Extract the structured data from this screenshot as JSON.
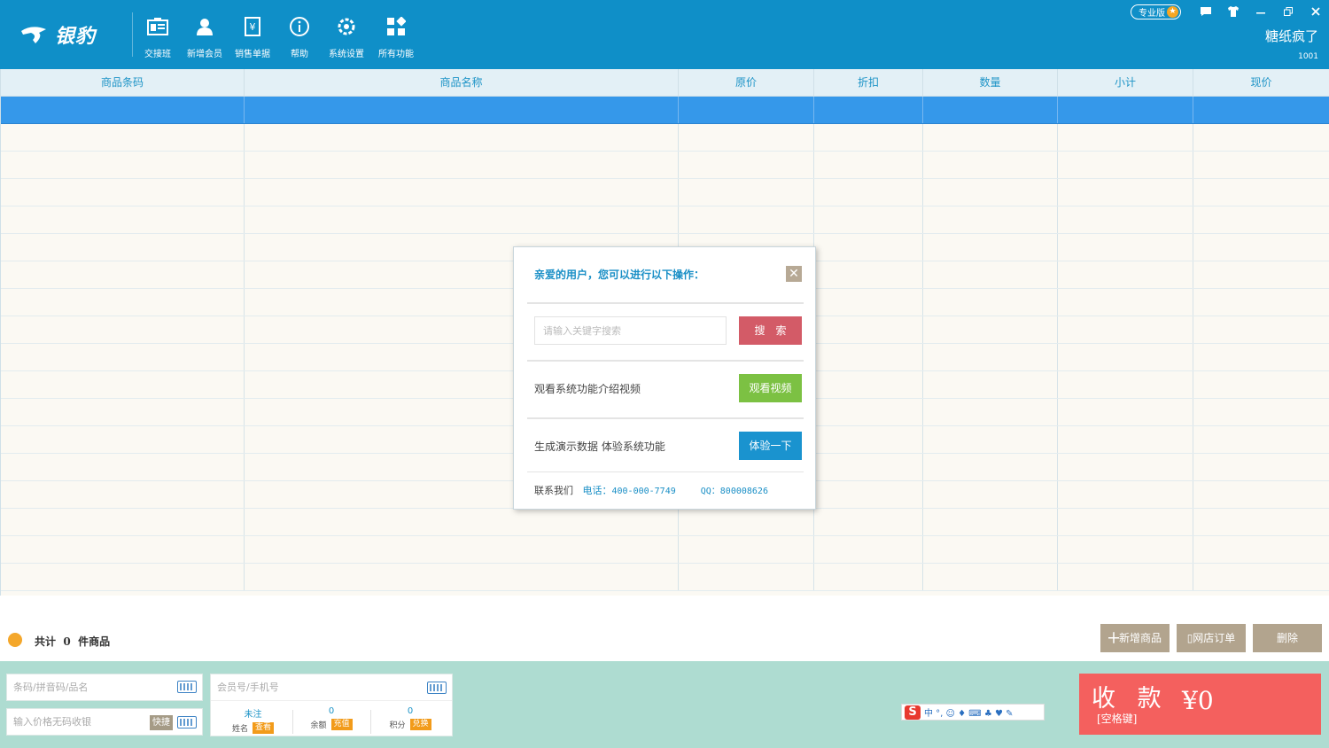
{
  "app": {
    "brand": "银豹"
  },
  "toolbar": {
    "items": [
      {
        "label": "交接班",
        "icon": "shift-handover-icon"
      },
      {
        "label": "新增会员",
        "icon": "add-member-icon"
      },
      {
        "label": "销售单据",
        "icon": "sales-receipt-icon"
      },
      {
        "label": "帮助",
        "icon": "help-icon"
      },
      {
        "label": "系统设置",
        "icon": "settings-gear-icon"
      },
      {
        "label": "所有功能",
        "icon": "all-functions-grid-icon"
      }
    ]
  },
  "window": {
    "edition_badge": "专业版"
  },
  "user": {
    "name": "糖纸疯了",
    "code": "1001"
  },
  "table": {
    "columns": [
      "商品条码",
      "商品名称",
      "原价",
      "折扣",
      "数量",
      "小计",
      "现价"
    ],
    "row_count": 18,
    "selected_row": 0
  },
  "dialog": {
    "title": "亲爱的用户，您可以进行以下操作：",
    "close_label": "✕",
    "search_placeholder": "请输入关键字搜索",
    "search_button": "搜　索",
    "video_text": "观看系统功能介绍视频",
    "video_button": "观看视频",
    "demo_text": "生成演示数据 体验系统功能",
    "demo_button": "体验一下",
    "contact_label": "联系我们",
    "phone_label": "电话：",
    "phone": "400-000-7749",
    "qq_label": "QQ：",
    "qq": "800008626"
  },
  "summary": {
    "prefix": "共计",
    "count": "0",
    "suffix": "件商品",
    "add_button": "╋新增商品",
    "online_order_button": "▯网店订单",
    "delete_button": "删除"
  },
  "bottom": {
    "barcode_placeholder": "条码/拼音码/品名",
    "price_placeholder": "输入价格无码收银",
    "quick_button": "快捷",
    "member_placeholder": "会员号/手机号",
    "member": {
      "name_value": "未注",
      "name_label": "姓名",
      "name_tag": "查看",
      "balance_value": "0",
      "balance_label": "余额",
      "balance_tag": "充值",
      "points_value": "0",
      "points_label": "积分",
      "points_tag": "兑换"
    },
    "ime_text": "中 °, ☺ ♦ ⌨ ♣ ♥ ✎",
    "pay_label": "收 款",
    "pay_hint": "[空格键]",
    "pay_amount": "¥0"
  },
  "colors": {
    "topbar": "#0f8fc8",
    "header_text": "#1e94c7",
    "selected_row": "#3598ea",
    "search_button": "#d35b67",
    "video_button": "#7cc143",
    "demo_button": "#1a93cf",
    "action_button": "#b2a48e",
    "pay": "#f4605e",
    "bottom_bg": "#aedcd1"
  }
}
